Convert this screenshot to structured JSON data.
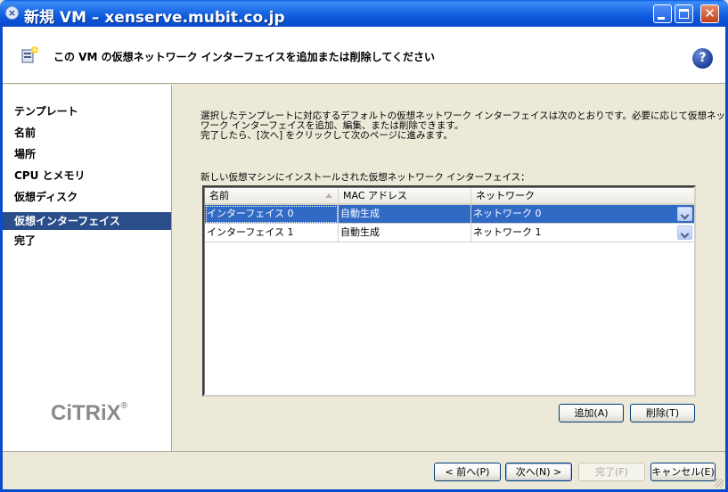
{
  "window": {
    "title": "新規 VM – xenserve.mubit.co.jp",
    "close_glyph": "✕"
  },
  "header": {
    "text": "この VM の仮想ネットワーク インターフェイスを追加または削除してください",
    "help_glyph": "?"
  },
  "sidebar": {
    "items": [
      {
        "label": "テンプレート"
      },
      {
        "label": "名前"
      },
      {
        "label": "場所"
      },
      {
        "label": "CPU とメモリ"
      },
      {
        "label": "仮想ディスク"
      },
      {
        "label": "仮想インターフェイス"
      },
      {
        "label": "完了"
      }
    ],
    "active_index": 5,
    "logo_text": "CiTRiX",
    "logo_mark": "®"
  },
  "main": {
    "description": [
      "選択したテンプレートに対応するデフォルトの仮想ネットワーク インターフェイスは次のとおりです。必要に応じて仮想ネット",
      "ワーク インターフェイスを追加、編集、または削除できます。",
      "完了したら、[次へ] をクリックして次のページに進みます。"
    ],
    "grid_label": "新しい仮想マシンにインストールされた仮想ネットワーク インターフェイス：",
    "columns": [
      "名前",
      "MAC アドレス",
      "ネットワーク"
    ],
    "rows": [
      {
        "name": "インターフェイス 0",
        "mac": "自動生成",
        "network": "ネットワーク 0"
      },
      {
        "name": "インターフェイス 1",
        "mac": "自動生成",
        "network": "ネットワーク 1"
      }
    ],
    "add_button": "追加(A)",
    "delete_button": "削除(T)"
  },
  "footer": {
    "back": "< 前へ(P)",
    "next": "次へ(N) >",
    "finish": "完了(F)",
    "cancel": "キャンセル(E)"
  },
  "colors": {
    "selection": "#316ac5",
    "active_nav": "#2a4e8a",
    "titlebar": "#0a55d8"
  }
}
